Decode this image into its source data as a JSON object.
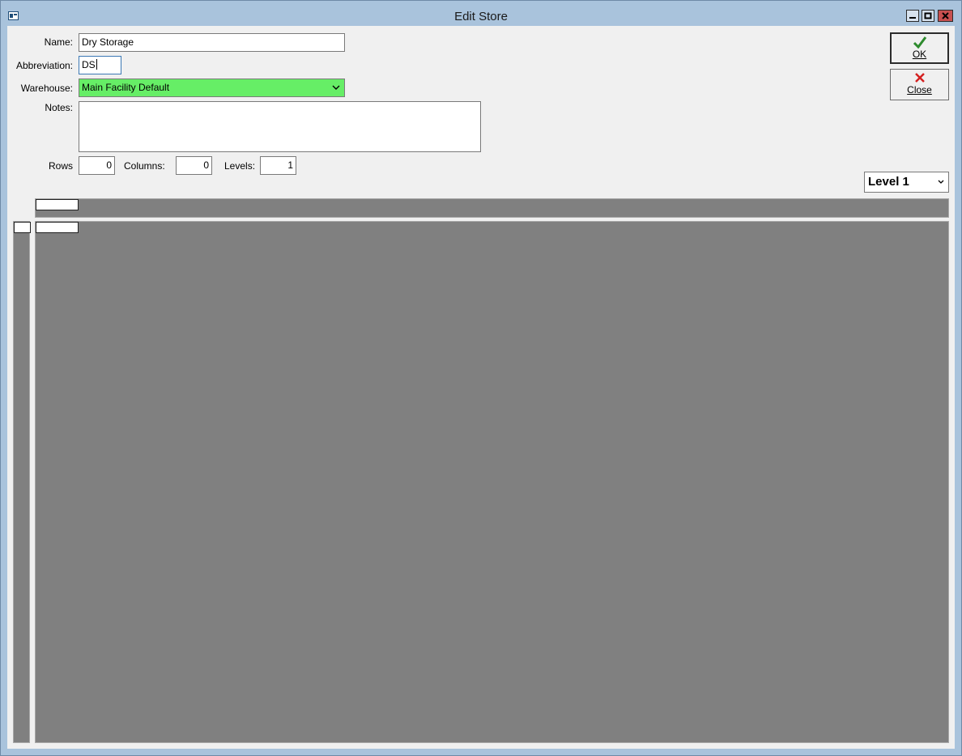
{
  "window": {
    "title": "Edit Store"
  },
  "form": {
    "name_label": "Name:",
    "name_value": "Dry Storage",
    "abbreviation_label": "Abbreviation:",
    "abbreviation_value": "DS",
    "warehouse_label": "Warehouse:",
    "warehouse_value": "Main Facility Default",
    "notes_label": "Notes:",
    "notes_value": "",
    "rows_label": "Rows",
    "rows_value": "0",
    "columns_label": "Columns:",
    "columns_value": "0",
    "levels_label": "Levels:",
    "levels_value": "1"
  },
  "buttons": {
    "ok_label": "OK",
    "close_label": "Close"
  },
  "level_select": {
    "value": "Level 1"
  },
  "colors": {
    "warehouse_bg": "#66ee66",
    "grid_bg": "#808080",
    "ok_icon": "#2e8b2e",
    "close_icon": "#d42020"
  },
  "icons": [
    "app-icon",
    "minimize-icon",
    "maximize-icon",
    "close-icon",
    "checkmark-icon",
    "x-icon",
    "chevron-down-icon"
  ]
}
